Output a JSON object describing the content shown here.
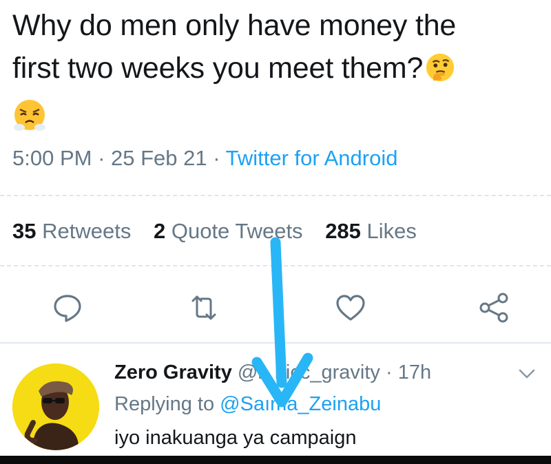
{
  "tweet": {
    "line1": "Why do men only have money the",
    "line2": "first two weeks you meet them?",
    "emoji_thinking": "thinking-face-emoji",
    "emoji_angry": "face-with-steam-emoji",
    "time": "5:00 PM",
    "sep1": " · ",
    "date": "25 Feb 21",
    "sep2": " · ",
    "source": "Twitter for Android"
  },
  "stats": {
    "retweets_count": "35",
    "retweets_label": "Retweets",
    "quotes_count": "2",
    "quotes_label": "Quote Tweets",
    "likes_count": "285",
    "likes_label": "Likes"
  },
  "actions": {
    "reply_icon": "comment-icon",
    "retweet_icon": "retweet-icon",
    "like_icon": "heart-icon",
    "share_icon": "share-icon"
  },
  "reply": {
    "name": "Zero Gravity",
    "handle_visible": "@i",
    "handle_rest": "nicc_gravity",
    "sep": " · ",
    "time": "17h",
    "replying_prefix": "Replying to ",
    "mention": "@Saıma_Zeinabu",
    "text": "iyo inakuanga ya campaign"
  },
  "colors": {
    "text": "#14171a",
    "muted": "#657786",
    "link": "#1da1f2",
    "arrow": "#29b6f6",
    "avatar_bg": "#f5dc14"
  }
}
